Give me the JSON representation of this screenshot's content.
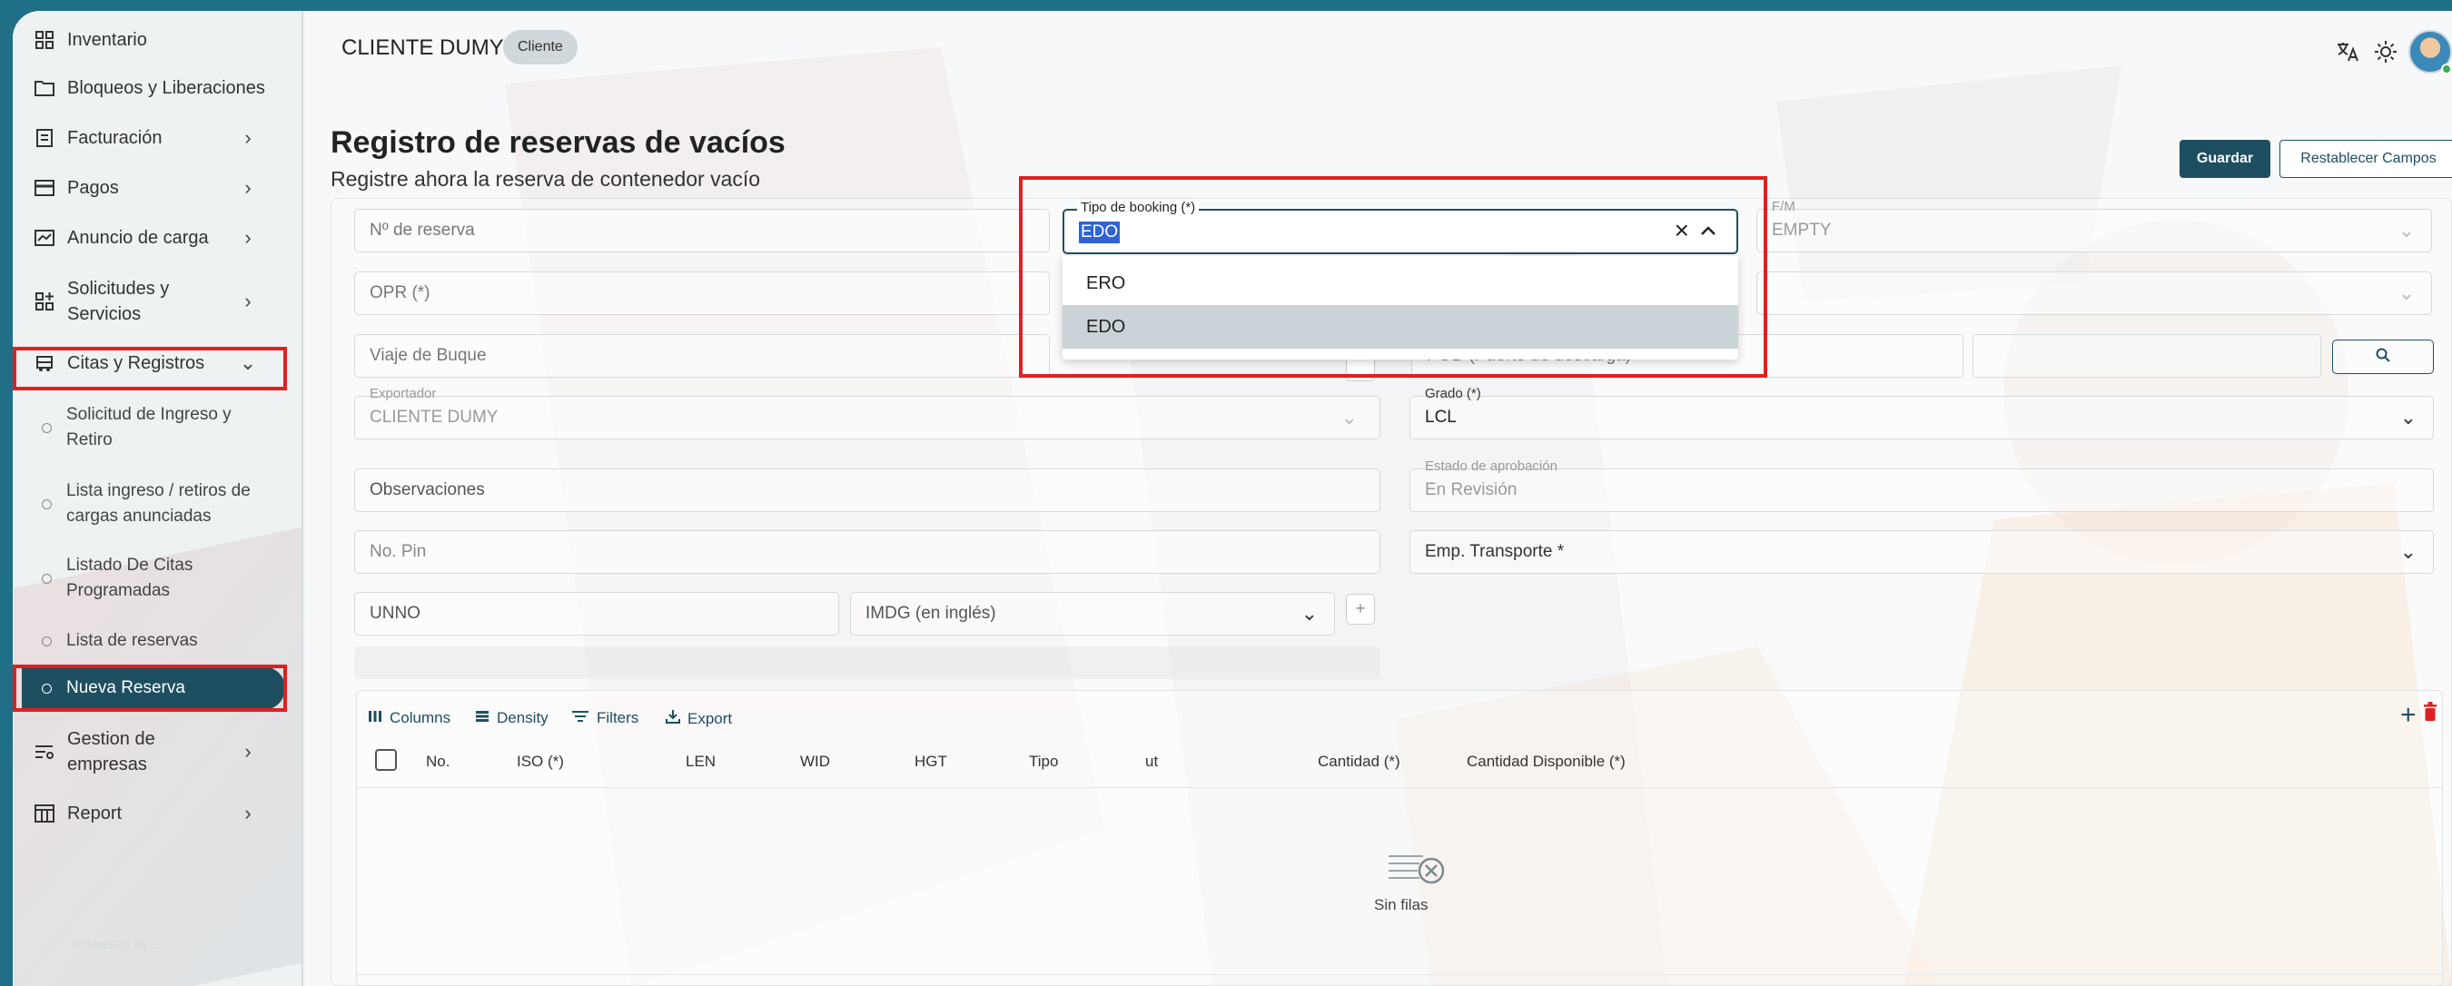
{
  "sidebar": {
    "items": [
      {
        "label": "Inventario",
        "icon": "grid-icon"
      },
      {
        "label": "Bloqueos y Liberaciones",
        "icon": "folder-icon"
      },
      {
        "label": "Facturación",
        "icon": "invoice-icon"
      },
      {
        "label": "Pagos",
        "icon": "card-icon"
      },
      {
        "label": "Anuncio de carga",
        "icon": "announcement-icon"
      },
      {
        "label_line1": "Solicitudes y",
        "label_line2": "Servicios",
        "icon": "apps-add-icon"
      },
      {
        "label": "Citas y Registros",
        "icon": "truck-icon"
      },
      {
        "label_line1": "Gestion de",
        "label_line2": "empresas",
        "icon": "filter-settings-icon"
      },
      {
        "label": "Report",
        "icon": "table-icon"
      }
    ],
    "sub_items": [
      {
        "line1": "Solicitud de Ingreso y",
        "line2": "Retiro"
      },
      {
        "line1": "Lista ingreso / retiros de",
        "line2": "cargas anunciadas"
      },
      {
        "line1": "Listado De Citas",
        "line2": "Programadas"
      },
      {
        "line1": "Lista de reservas"
      },
      {
        "line1": "Nueva Reserva"
      }
    ],
    "footer_faint": "Powered by..."
  },
  "header": {
    "client_name": "CLIENTE DUMY",
    "client_chip": "Cliente",
    "icons": [
      "translate-icon",
      "sun-icon",
      "avatar"
    ]
  },
  "page": {
    "title": "Registro de reservas de vacíos",
    "subtitle": "Registre ahora la reserva de contenedor vacío",
    "save_button": "Guardar",
    "reset_button": "Restablecer Campos"
  },
  "form": {
    "reserva_placeholder": "Nº de reserva",
    "booking_label": "Tipo de booking (*)",
    "booking_value": "EDO",
    "booking_options": [
      "ERO",
      "EDO"
    ],
    "booking_highlighted": "EDO",
    "fm_label": "F/M",
    "fm_value": "EMPTY",
    "opr_placeholder": "OPR (*)",
    "viaje_placeholder": "Viaje de Buque",
    "pod_placeholder": "POD (Puerto de descarga)",
    "exportador_label": "Exportador",
    "exportador_value": "CLIENTE DUMY",
    "grado_label": "Grado (*)",
    "grado_value": "LCL",
    "observaciones_placeholder": "Observaciones",
    "estado_label": "Estado de aprobación",
    "estado_value": "En Revisión",
    "pin_placeholder": "No. Pin",
    "transporte_placeholder": "Emp. Transporte *",
    "unno_placeholder": "UNNO",
    "imdg_placeholder": "IMDG (en inglés)",
    "plus_symbol": "+"
  },
  "grid": {
    "toolbar": {
      "columns": "Columns",
      "density": "Density",
      "filters": "Filters",
      "export": "Export"
    },
    "headers": [
      "No.",
      "ISO (*)",
      "LEN",
      "WID",
      "HGT",
      "Tipo",
      "ut",
      "Cantidad (*)",
      "Cantidad Disponible (*)"
    ],
    "empty_text": "Sin filas",
    "add_symbol": "+"
  },
  "colors": {
    "accent": "#1d4f60",
    "frame": "#1f6f86",
    "highlight_box": "#e02020",
    "selected_text_bg": "#2f63d4",
    "delete": "#e02020"
  }
}
